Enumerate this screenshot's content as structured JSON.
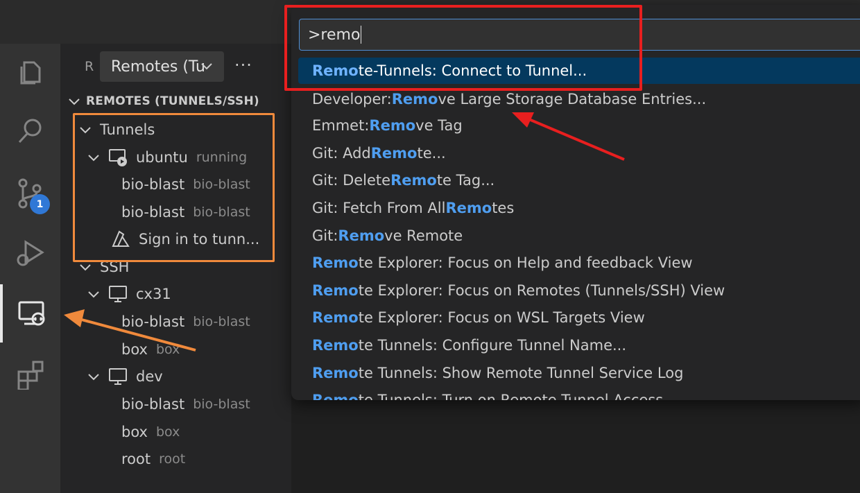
{
  "sidebar": {
    "header_letter": "R",
    "view_select": "Remotes (Tu",
    "more_actions": "···",
    "section_title": "REMOTES (TUNNELS/SSH)",
    "tunnels_label": "Tunnels",
    "tunnel_host": {
      "name": "ubuntu",
      "status": "running"
    },
    "tunnel_items": [
      {
        "name": "bio-blast",
        "desc": "bio-blast"
      },
      {
        "name": "bio-blast",
        "desc": "bio-blast"
      }
    ],
    "sign_in": "Sign in to tunn...",
    "ssh_label": "SSH",
    "ssh_hosts": [
      {
        "name": "cx31",
        "items": [
          {
            "name": "bio-blast",
            "desc": "bio-blast"
          },
          {
            "name": "box",
            "desc": "box"
          }
        ]
      },
      {
        "name": "dev",
        "items": [
          {
            "name": "bio-blast",
            "desc": "bio-blast"
          },
          {
            "name": "box",
            "desc": "box"
          },
          {
            "name": "root",
            "desc": "root"
          }
        ]
      }
    ]
  },
  "activity": {
    "source_control_badge": "1"
  },
  "palette": {
    "query": ">remo",
    "items": [
      {
        "pre": "",
        "hl": "Remo",
        "post": "te-Tunnels: Connect to Tunnel..."
      },
      {
        "pre": "Developer: ",
        "hl": "Remo",
        "post": "ve Large Storage Database Entries..."
      },
      {
        "pre": "Emmet: ",
        "hl": "Remo",
        "post": "ve Tag"
      },
      {
        "pre": "Git: Add ",
        "hl": "Remo",
        "post": "te..."
      },
      {
        "pre": "Git: Delete ",
        "hl": "Remo",
        "post": "te Tag..."
      },
      {
        "pre": "Git: Fetch From All ",
        "hl": "Remo",
        "post": "tes"
      },
      {
        "pre": "Git: ",
        "hl": "Remo",
        "post": "ve Remote"
      },
      {
        "pre": "",
        "hl": "Remo",
        "post": "te Explorer: Focus on Help and feedback View"
      },
      {
        "pre": "",
        "hl": "Remo",
        "post": "te Explorer: Focus on Remotes (Tunnels/SSH) View"
      },
      {
        "pre": "",
        "hl": "Remo",
        "post": "te Explorer: Focus on WSL Targets View"
      },
      {
        "pre": "",
        "hl": "Remo",
        "post": "te Tunnels: Configure Tunnel Name..."
      },
      {
        "pre": "",
        "hl": "Remo",
        "post": "te Tunnels: Show Remote Tunnel Service Log"
      },
      {
        "pre": "",
        "hl": "Remo",
        "post": "te Tunnels: Turn on Remote Tunnel Access..."
      }
    ]
  },
  "colors": {
    "highlight": "#4f9ef0",
    "selection": "#04395e",
    "annotation_red": "#e81f1f",
    "annotation_orange": "#f08a3c"
  }
}
